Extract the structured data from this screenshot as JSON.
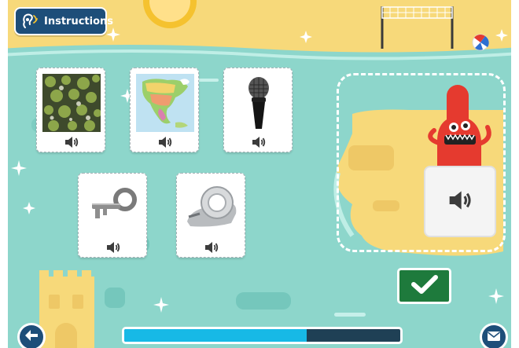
{
  "header": {
    "instructions_label": "Instructions"
  },
  "cards": [
    {
      "image": "moss-covered-rocks",
      "audio_icon": "speaker-icon"
    },
    {
      "image": "north-america-map",
      "audio_icon": "speaker-icon"
    },
    {
      "image": "microphone",
      "audio_icon": "speaker-icon"
    },
    {
      "image": "metal-key",
      "audio_icon": "speaker-icon"
    },
    {
      "image": "tape-dispenser",
      "audio_icon": "speaker-icon"
    }
  ],
  "answer_card": {
    "audio_icon": "speaker-icon"
  },
  "progress": {
    "fraction": 0.66
  },
  "colors": {
    "sea": "#8dd6cb",
    "sand": "#f7d97a",
    "button_blue": "#1d4e79",
    "check_green": "#1e7a3c",
    "progress_fill": "#17b9e6",
    "monster_red": "#e53a2f"
  }
}
